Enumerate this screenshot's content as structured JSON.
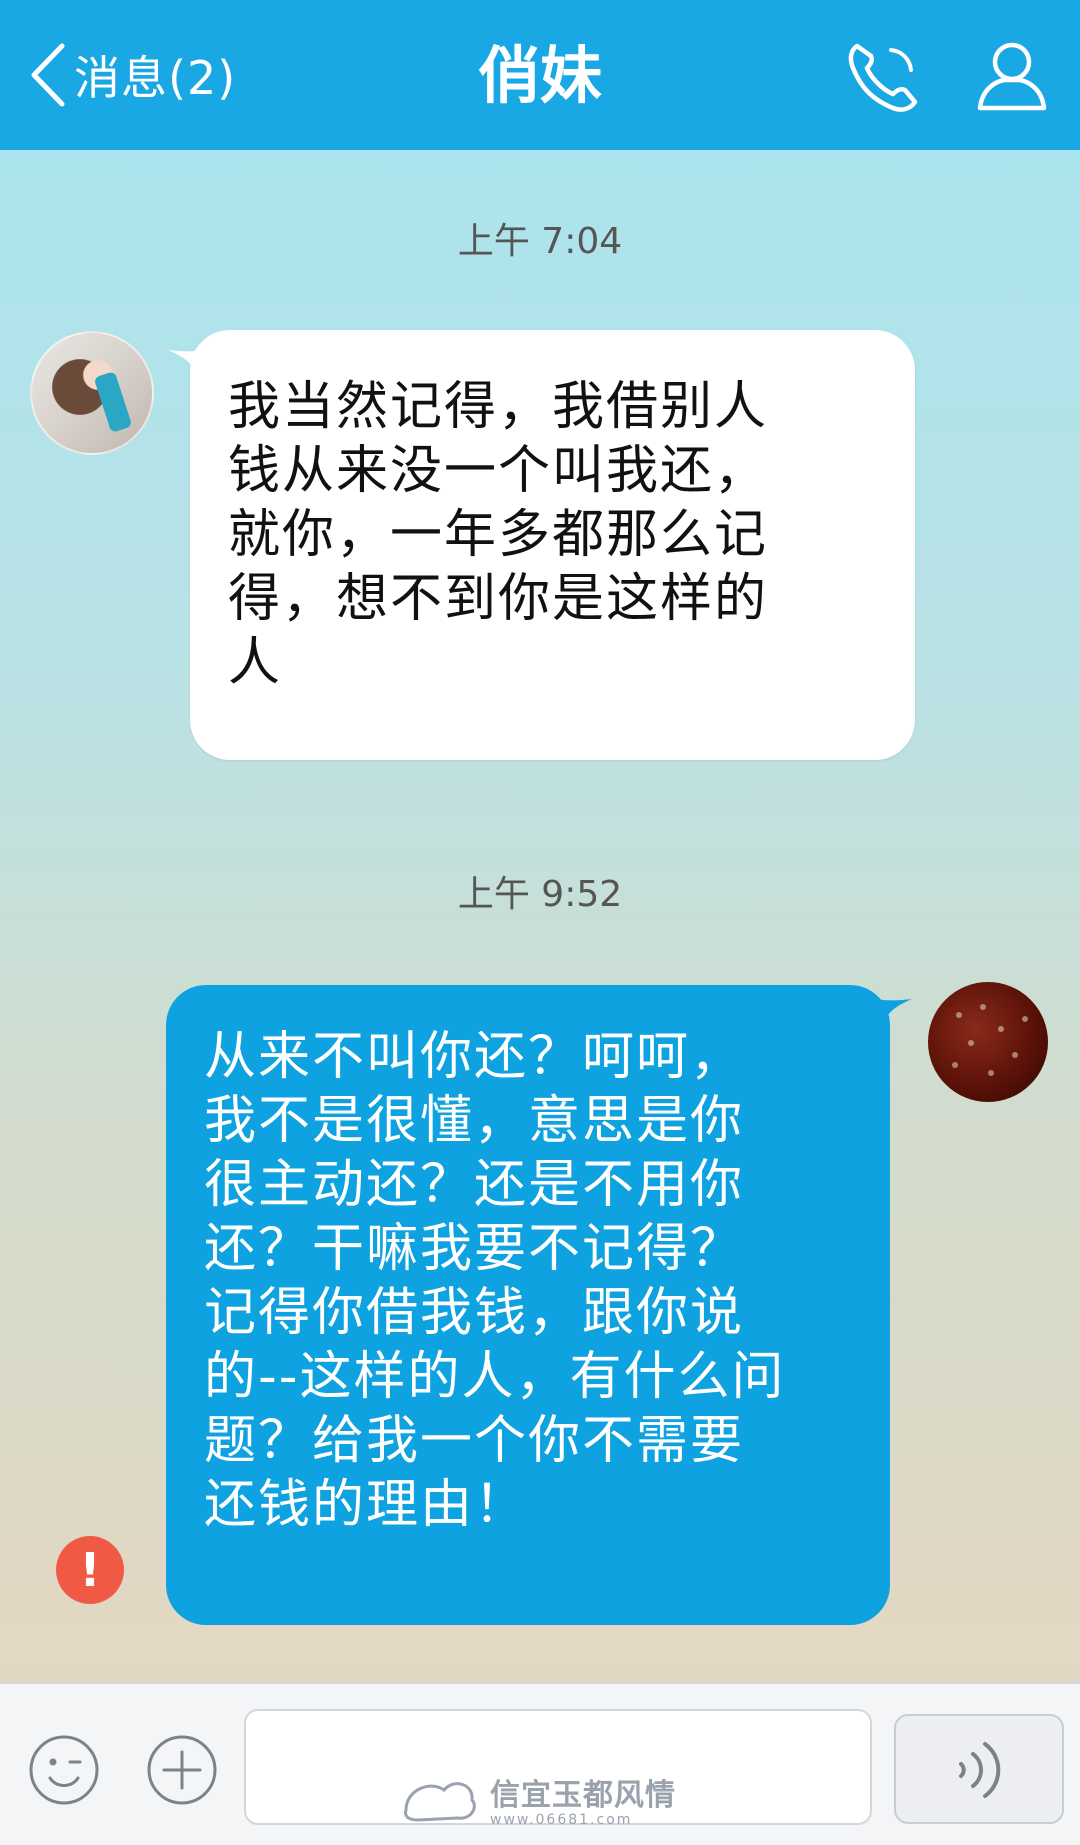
{
  "header": {
    "back_label": "消息(2)",
    "title": "俏妹",
    "background_color": "#1aa8e4"
  },
  "icons": {
    "back": "chevron-left-icon",
    "call": "phone-icon",
    "profile": "person-icon",
    "emoji": "smile-icon",
    "plus": "plus-icon",
    "voice": "voice-icon",
    "error": "exclamation-icon"
  },
  "messages": [
    {
      "time": "上午 7:04",
      "direction": "incoming",
      "text": "我当然记得，我借别人\n钱从来没一个叫我还，\n就你，一年多都那么记\n得，想不到你是这样的\n人",
      "bubble_color": "#ffffff"
    },
    {
      "time": "上午 9:52",
      "direction": "outgoing",
      "text": "从来不叫你还？呵呵，\n我不是很懂，意思是你\n很主动还？还是不用你\n还？干嘛我要不记得？\n记得你借我钱，跟你说\n的--这样的人，有什么问\n题？给我一个你不需要\n还钱的理由！",
      "bubble_color": "#0ea2e0",
      "failed": true,
      "error_mark": "!"
    }
  ],
  "input": {
    "value": "",
    "placeholder": ""
  },
  "watermark": {
    "text": "信宜玉都风情",
    "url": "www.06681.com"
  }
}
